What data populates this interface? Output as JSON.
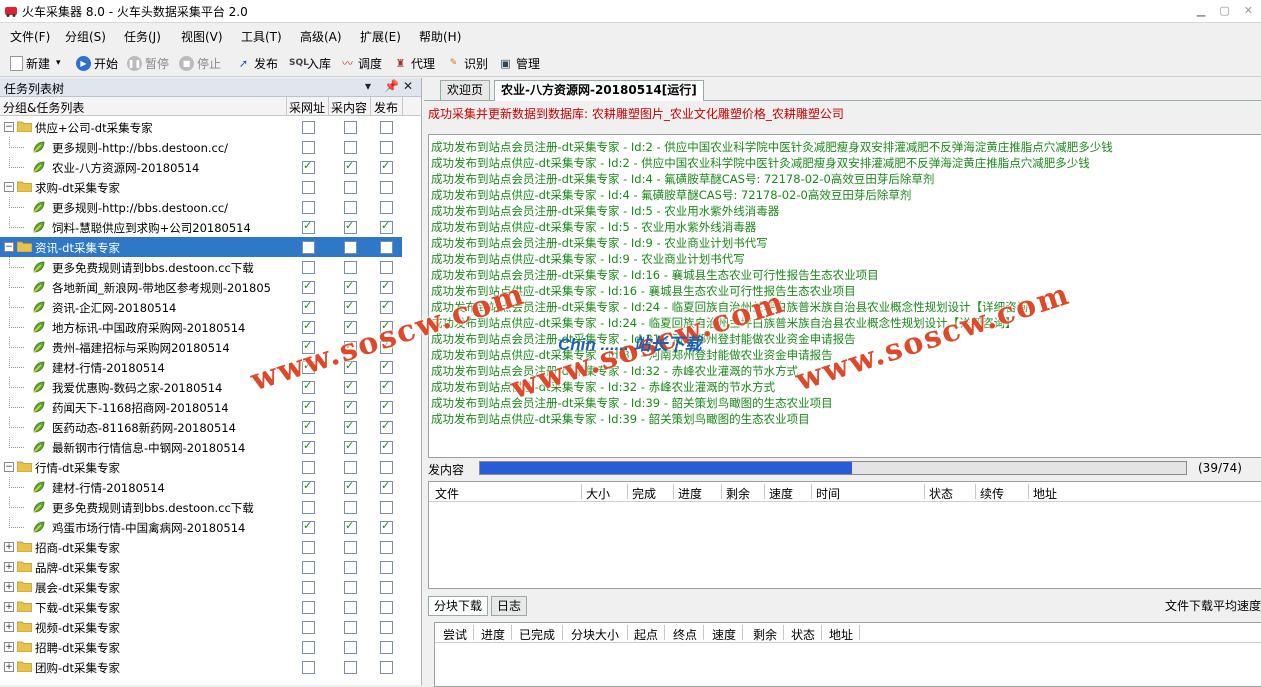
{
  "window": {
    "title": "火车采集器 8.0 - 火车头数据采集平台 2.0"
  },
  "menu": [
    "文件(F)",
    "分组(S)",
    "任务(J)",
    "视图(V)",
    "工具(T)",
    "高级(A)",
    "扩展(E)",
    "帮助(H)"
  ],
  "toolbar": {
    "new": "新建",
    "start": "开始",
    "pause": "暂停",
    "stop": "停止",
    "publish": "发布",
    "import": "入库",
    "schedule": "调度",
    "proxy": "代理",
    "identify": "识别",
    "manage": "管理"
  },
  "left": {
    "title": "任务列表树",
    "pin": "▾ ⅁ ✕",
    "col_tree": "分组&任务列表",
    "col_a": "采网址",
    "col_b": "采内容",
    "col_c": "发布",
    "rows": [
      {
        "label": "供应+公司-dt采集专家",
        "lvl": 0,
        "type": "group",
        "exp": "−",
        "cb": [
          0,
          0,
          0
        ]
      },
      {
        "label": "更多规则-http://bbs.destoon.cc/",
        "lvl": 1,
        "type": "task",
        "cb": [
          0,
          0,
          0
        ]
      },
      {
        "label": "农业-八方资源网-20180514",
        "lvl": 1,
        "type": "task",
        "cb": [
          1,
          1,
          1
        ]
      },
      {
        "label": "求购-dt采集专家",
        "lvl": 0,
        "type": "group",
        "exp": "−",
        "cb": [
          0,
          0,
          0
        ]
      },
      {
        "label": "更多规则-http://bbs.destoon.cc/",
        "lvl": 1,
        "type": "task",
        "cb": [
          0,
          0,
          0
        ]
      },
      {
        "label": "饲料-慧聪供应到求购+公司20180514",
        "lvl": 1,
        "type": "task",
        "cb": [
          1,
          1,
          1
        ]
      },
      {
        "label": "资讯-dt采集专家",
        "lvl": 0,
        "type": "group",
        "exp": "−",
        "cb": [
          0,
          0,
          0
        ],
        "sel": true
      },
      {
        "label": "更多免费规则请到bbs.destoon.cc下载",
        "lvl": 1,
        "type": "task",
        "cb": [
          0,
          0,
          0
        ]
      },
      {
        "label": "各地新闻_新浪网-带地区参考规则-201805",
        "lvl": 1,
        "type": "task",
        "cb": [
          1,
          1,
          1
        ]
      },
      {
        "label": "资讯-企汇网-20180514",
        "lvl": 1,
        "type": "task",
        "cb": [
          1,
          1,
          1
        ]
      },
      {
        "label": "地方标讯-中国政府采购网-20180514",
        "lvl": 1,
        "type": "task",
        "cb": [
          1,
          1,
          1
        ]
      },
      {
        "label": "贵州-福建招标与采购网20180514",
        "lvl": 1,
        "type": "task",
        "cb": [
          1,
          1,
          1
        ]
      },
      {
        "label": "建材-行情-20180514",
        "lvl": 1,
        "type": "task",
        "cb": [
          1,
          1,
          1
        ]
      },
      {
        "label": "我爱优惠购-数码之家-20180514",
        "lvl": 1,
        "type": "task",
        "cb": [
          1,
          1,
          1
        ]
      },
      {
        "label": "药闻天下-1168招商网-20180514",
        "lvl": 1,
        "type": "task",
        "cb": [
          1,
          1,
          1
        ]
      },
      {
        "label": "医药动态-81168新药网-20180514",
        "lvl": 1,
        "type": "task",
        "cb": [
          1,
          1,
          1
        ]
      },
      {
        "label": "最新钢市行情信息-中钢网-20180514",
        "lvl": 1,
        "type": "task",
        "cb": [
          1,
          1,
          1
        ]
      },
      {
        "label": "行情-dt采集专家",
        "lvl": 0,
        "type": "group",
        "exp": "−",
        "cb": [
          0,
          0,
          0
        ]
      },
      {
        "label": "建材-行情-20180514",
        "lvl": 1,
        "type": "task",
        "cb": [
          1,
          1,
          1
        ]
      },
      {
        "label": "更多免费规则请到bbs.destoon.cc下载",
        "lvl": 1,
        "type": "task",
        "cb": [
          0,
          0,
          0
        ]
      },
      {
        "label": "鸡蛋市场行情-中国禽病网-20180514",
        "lvl": 1,
        "type": "task",
        "cb": [
          1,
          1,
          1
        ]
      },
      {
        "label": "招商-dt采集专家",
        "lvl": 0,
        "type": "group",
        "exp": "+",
        "cb": [
          0,
          0,
          0
        ]
      },
      {
        "label": "品牌-dt采集专家",
        "lvl": 0,
        "type": "group",
        "exp": "+",
        "cb": [
          0,
          0,
          0
        ]
      },
      {
        "label": "展会-dt采集专家",
        "lvl": 0,
        "type": "group",
        "exp": "+",
        "cb": [
          0,
          0,
          0
        ]
      },
      {
        "label": "下载-dt采集专家",
        "lvl": 0,
        "type": "group",
        "exp": "+",
        "cb": [
          0,
          0,
          0
        ]
      },
      {
        "label": "视频-dt采集专家",
        "lvl": 0,
        "type": "group",
        "exp": "+",
        "cb": [
          0,
          0,
          0
        ]
      },
      {
        "label": "招聘-dt采集专家",
        "lvl": 0,
        "type": "group",
        "exp": "+",
        "cb": [
          0,
          0,
          0
        ]
      },
      {
        "label": "团购-dt采集专家",
        "lvl": 0,
        "type": "group",
        "exp": "+",
        "cb": [
          0,
          0,
          0
        ]
      }
    ]
  },
  "right": {
    "tab_welcome": "欢迎页",
    "tab_task": "农业-八方资源网-20180514[运行]",
    "info": "成功采集并更新数据到数据库: 农耕雕塑图片_农业文化雕塑价格_农耕雕塑公司",
    "log": [
      "成功发布到站点会员注册-dt采集专家 - Id:2 - 供应中国农业科学院中医针灸减肥瘦身双安排灌减肥不反弹海淀黄庄推脂点穴减肥多少钱",
      "成功发布到站点供应-dt采集专家 - Id:2 - 供应中国农业科学院中医针灸减肥瘦身双安排灌减肥不反弹海淀黄庄推脂点穴减肥多少钱",
      "成功发布到站点会员注册-dt采集专家 - Id:4 - 氟磺胺草醚CAS号: 72178-02-0高效豆田芽后除草剂",
      "成功发布到站点供应-dt采集专家 - Id:4 - 氟磺胺草醚CAS号: 72178-02-0高效豆田芽后除草剂",
      "成功发布到站点会员注册-dt采集专家 - Id:5 - 农业用水紫外线消毒器",
      "成功发布到站点供应-dt采集专家 - Id:5 - 农业用水紫外线消毒器",
      "成功发布到站点会员注册-dt采集专家 - Id:9 - 农业商业计划书代写",
      "成功发布到站点供应-dt采集专家 - Id:9 - 农业商业计划书代写",
      "成功发布到站点会员注册-dt采集专家 - Id:16 - 襄城县生态农业可行性报告生态农业项目",
      "成功发布到站点供应-dt采集专家 - Id:16 - 襄城县生态农业可行性报告生态农业项目",
      "成功发布到站点会员注册-dt采集专家 - Id:24 - 临夏回族自治州兰坪白族普米族自治县农业概念性规划设计【详细咨询】",
      "成功发布到站点供应-dt采集专家 - Id:24 - 临夏回族自治州兰坪白族普米族自治县农业概念性规划设计【详细咨询】",
      "成功发布到站点会员注册-dt采集专家 - Id:31 - 河南郑州登封能做农业资金申请报告",
      "成功发布到站点供应-dt采集专家 - Id:31 - 河南郑州登封能做农业资金申请报告",
      "成功发布到站点会员注册-dt采集专家 - Id:32 - 赤峰农业灌溉的节水方式",
      "成功发布到站点供应-dt采集专家 - Id:32 - 赤峰农业灌溉的节水方式",
      "成功发布到站点会员注册-dt采集专家 - Id:39 - 韶关策划鸟瞰图的生态农业项目",
      "成功发布到站点供应-dt采集专家 - Id:39 - 韶关策划鸟瞰图的生态农业项目"
    ],
    "send_label": "发内容",
    "progress": {
      "done": 39,
      "total": 74,
      "text": "(39/74)"
    },
    "file_cols": [
      "文件",
      "大小",
      "完成",
      "进度",
      "剩余",
      "速度",
      "时间",
      "状态",
      "续传",
      "地址"
    ],
    "btab_chunk": "分块下载",
    "btab_log": "日志",
    "avg_speed": "文件下载平均速度",
    "chunk_cols": [
      "尝试",
      "进度",
      "已完成",
      "分块大小",
      "起点",
      "终点",
      "速度",
      "剩余",
      "状态",
      "地址"
    ]
  },
  "watermark": {
    "text": "www.soscw.com",
    "brand": "Chin  ...... 站长下载"
  },
  "colors": {
    "selection": "#2f78c8",
    "log_text": "#1b8a1b",
    "info_text": "#cc0000",
    "progress": "#2a5bd7"
  }
}
